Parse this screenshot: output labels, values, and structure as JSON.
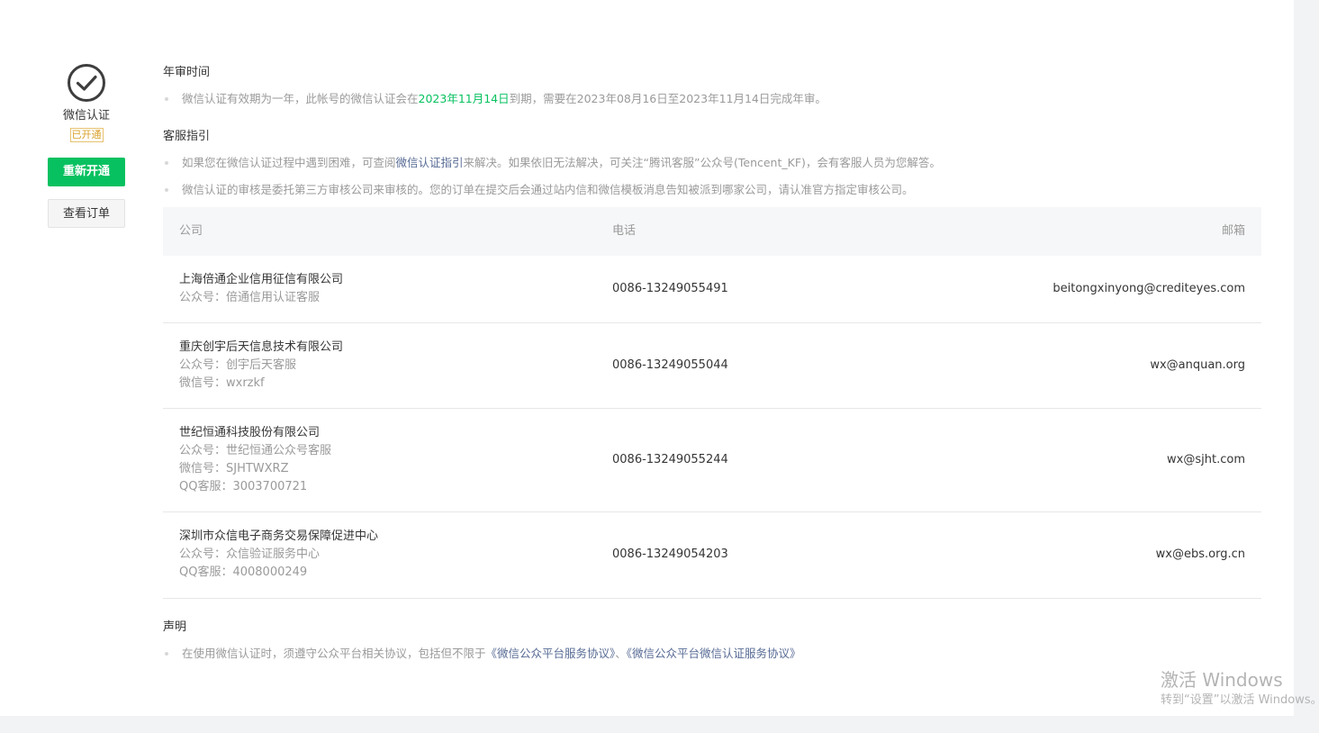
{
  "service": {
    "name": "微信认证",
    "status_badge": "已开通",
    "renew_button": "重新开通",
    "view_orders_button": "查看订单"
  },
  "annual_review": {
    "title": "年审时间",
    "text_prefix": "微信认证有效期为一年，此帐号的微信认证会在",
    "expiry_date": "2023年11月14日",
    "text_suffix": "到期，需要在2023年08月16日至2023年11月14日完成年审。"
  },
  "support": {
    "title": "客服指引",
    "item1_prefix": "如果您在微信认证过程中遇到困难，可查阅",
    "item1_link": "微信认证指引",
    "item1_suffix": "来解决。如果依旧无法解决，可关注“腾讯客服”公众号(Tencent_KF)，会有客服人员为您解答。",
    "item2": "微信认证的审核是委托第三方审核公司来审核的。您的订单在提交后会通过站内信和微信模板消息告知被派到哪家公司，请认准官方指定审核公司。"
  },
  "table": {
    "headers": {
      "company": "公司",
      "phone": "电话",
      "email": "邮箱"
    },
    "rows": [
      {
        "company": "上海倍通企业信用征信有限公司",
        "details": [
          "公众号：倍通信用认证客服"
        ],
        "phone": "0086-13249055491",
        "email": "beitongxinyong@crediteyes.com"
      },
      {
        "company": "重庆创宇后天信息技术有限公司",
        "details": [
          "公众号：创宇后天客服",
          "微信号：wxrzkf"
        ],
        "phone": "0086-13249055044",
        "email": "wx@anquan.org"
      },
      {
        "company": "世纪恒通科技股份有限公司",
        "details": [
          "公众号：世纪恒通公众号客服",
          "微信号：SJHTWXRZ",
          "QQ客服：3003700721"
        ],
        "phone": "0086-13249055244",
        "email": "wx@sjht.com"
      },
      {
        "company": "深圳市众信电子商务交易保障促进中心",
        "details": [
          "公众号：众信验证服务中心",
          "QQ客服：4008000249"
        ],
        "phone": "0086-13249054203",
        "email": "wx@ebs.org.cn"
      }
    ]
  },
  "statement": {
    "title": "声明",
    "text_prefix": "在使用微信认证时，须遵守公众平台相关协议，包括但不限于",
    "link1": "《微信公众平台服务协议》",
    "separator": "、",
    "link2": "《微信公众平台微信认证服务协议》"
  },
  "watermark": {
    "line1": "激活 Windows",
    "line2": "转到“设置”以激活 Windows。"
  },
  "colors": {
    "accent": "#07c160",
    "link": "#576b95",
    "badge": "#d8a02a"
  }
}
